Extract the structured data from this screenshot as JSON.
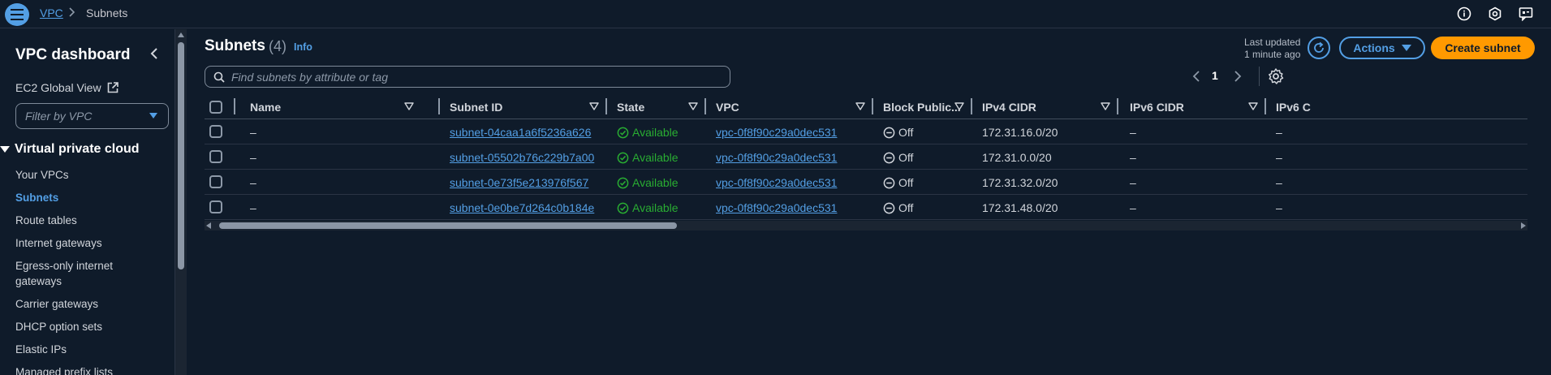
{
  "breadcrumb": {
    "service": "VPC",
    "separator": ">",
    "current": "Subnets"
  },
  "topbar_icons": [
    "info-icon",
    "hexagon-settings-icon",
    "feedback-icon"
  ],
  "sidebar": {
    "title": "VPC dashboard",
    "ec2_global_view": "EC2 Global View",
    "filter_placeholder": "Filter by VPC",
    "section": "Virtual private cloud",
    "items": [
      {
        "label": "Your VPCs",
        "active": false
      },
      {
        "label": "Subnets",
        "active": true
      },
      {
        "label": "Route tables",
        "active": false
      },
      {
        "label": "Internet gateways",
        "active": false
      },
      {
        "label": "Egress-only internet gateways",
        "active": false
      },
      {
        "label": "Carrier gateways",
        "active": false
      },
      {
        "label": "DHCP option sets",
        "active": false
      },
      {
        "label": "Elastic IPs",
        "active": false
      },
      {
        "label": "Managed prefix lists",
        "active": false
      }
    ]
  },
  "header": {
    "title": "Subnets",
    "count": "(4)",
    "info": "Info",
    "last_updated_label": "Last updated",
    "last_updated_value": "1 minute ago",
    "actions_label": "Actions",
    "create_label": "Create subnet",
    "search_placeholder": "Find subnets by attribute or tag",
    "page": "1"
  },
  "table": {
    "columns": [
      "Name",
      "Subnet ID",
      "State",
      "VPC",
      "Block Public...",
      "IPv4 CIDR",
      "IPv6 CIDR",
      "IPv6 C"
    ],
    "rows": [
      {
        "name": "–",
        "subnet_id": "subnet-04caa1a6f5236a626",
        "state": "Available",
        "vpc": "vpc-0f8f90c29a0dec531",
        "block_public": "Off",
        "ipv4": "172.31.16.0/20",
        "ipv6": "–",
        "ipv6b": "–"
      },
      {
        "name": "–",
        "subnet_id": "subnet-05502b76c229b7a00",
        "state": "Available",
        "vpc": "vpc-0f8f90c29a0dec531",
        "block_public": "Off",
        "ipv4": "172.31.0.0/20",
        "ipv6": "–",
        "ipv6b": "–"
      },
      {
        "name": "–",
        "subnet_id": "subnet-0e73f5e213976f567",
        "state": "Available",
        "vpc": "vpc-0f8f90c29a0dec531",
        "block_public": "Off",
        "ipv4": "172.31.32.0/20",
        "ipv6": "–",
        "ipv6b": "–"
      },
      {
        "name": "–",
        "subnet_id": "subnet-0e0be7d264c0b184e",
        "state": "Available",
        "vpc": "vpc-0f8f90c29a0dec531",
        "block_public": "Off",
        "ipv4": "172.31.48.0/20",
        "ipv6": "–",
        "ipv6b": "–"
      }
    ]
  },
  "colors": {
    "accent": "#539fe5",
    "primary_button": "#ff9900",
    "available": "#29ad32",
    "background": "#0f1b2a"
  }
}
